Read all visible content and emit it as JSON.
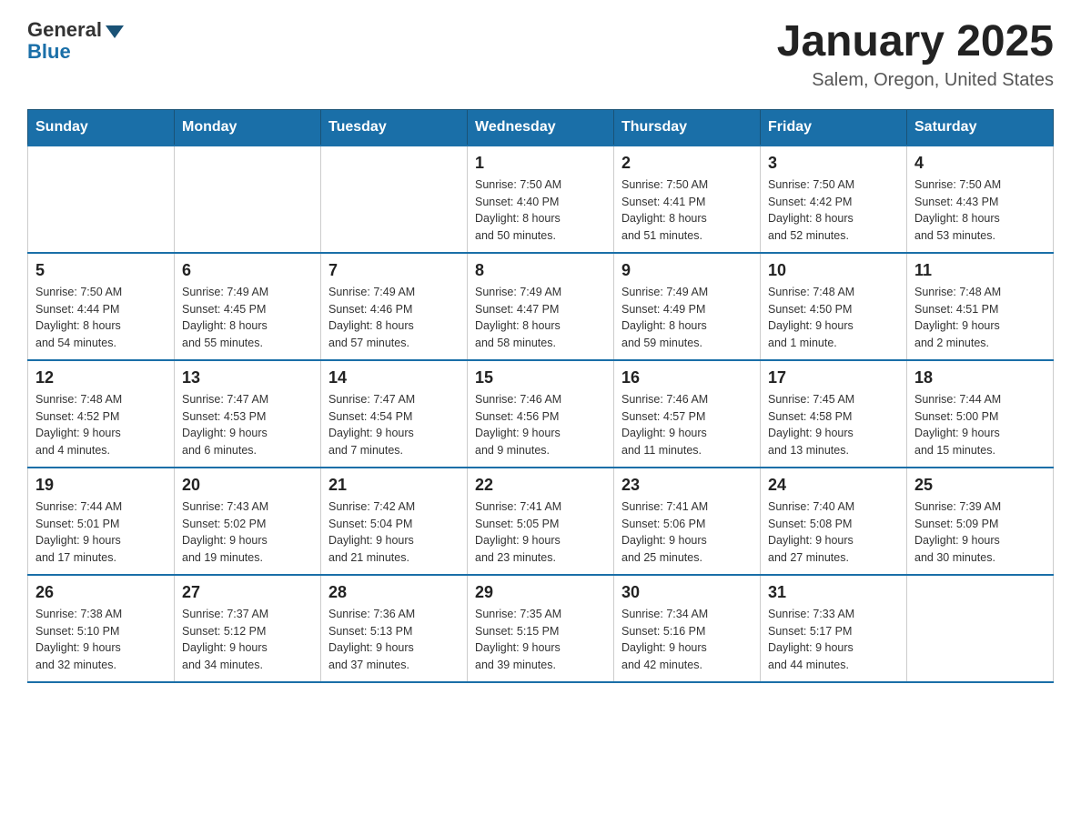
{
  "header": {
    "logo_general": "General",
    "logo_blue": "Blue",
    "month_title": "January 2025",
    "location": "Salem, Oregon, United States"
  },
  "days_of_week": [
    "Sunday",
    "Monday",
    "Tuesday",
    "Wednesday",
    "Thursday",
    "Friday",
    "Saturday"
  ],
  "weeks": [
    [
      {
        "day": "",
        "info": ""
      },
      {
        "day": "",
        "info": ""
      },
      {
        "day": "",
        "info": ""
      },
      {
        "day": "1",
        "info": "Sunrise: 7:50 AM\nSunset: 4:40 PM\nDaylight: 8 hours\nand 50 minutes."
      },
      {
        "day": "2",
        "info": "Sunrise: 7:50 AM\nSunset: 4:41 PM\nDaylight: 8 hours\nand 51 minutes."
      },
      {
        "day": "3",
        "info": "Sunrise: 7:50 AM\nSunset: 4:42 PM\nDaylight: 8 hours\nand 52 minutes."
      },
      {
        "day": "4",
        "info": "Sunrise: 7:50 AM\nSunset: 4:43 PM\nDaylight: 8 hours\nand 53 minutes."
      }
    ],
    [
      {
        "day": "5",
        "info": "Sunrise: 7:50 AM\nSunset: 4:44 PM\nDaylight: 8 hours\nand 54 minutes."
      },
      {
        "day": "6",
        "info": "Sunrise: 7:49 AM\nSunset: 4:45 PM\nDaylight: 8 hours\nand 55 minutes."
      },
      {
        "day": "7",
        "info": "Sunrise: 7:49 AM\nSunset: 4:46 PM\nDaylight: 8 hours\nand 57 minutes."
      },
      {
        "day": "8",
        "info": "Sunrise: 7:49 AM\nSunset: 4:47 PM\nDaylight: 8 hours\nand 58 minutes."
      },
      {
        "day": "9",
        "info": "Sunrise: 7:49 AM\nSunset: 4:49 PM\nDaylight: 8 hours\nand 59 minutes."
      },
      {
        "day": "10",
        "info": "Sunrise: 7:48 AM\nSunset: 4:50 PM\nDaylight: 9 hours\nand 1 minute."
      },
      {
        "day": "11",
        "info": "Sunrise: 7:48 AM\nSunset: 4:51 PM\nDaylight: 9 hours\nand 2 minutes."
      }
    ],
    [
      {
        "day": "12",
        "info": "Sunrise: 7:48 AM\nSunset: 4:52 PM\nDaylight: 9 hours\nand 4 minutes."
      },
      {
        "day": "13",
        "info": "Sunrise: 7:47 AM\nSunset: 4:53 PM\nDaylight: 9 hours\nand 6 minutes."
      },
      {
        "day": "14",
        "info": "Sunrise: 7:47 AM\nSunset: 4:54 PM\nDaylight: 9 hours\nand 7 minutes."
      },
      {
        "day": "15",
        "info": "Sunrise: 7:46 AM\nSunset: 4:56 PM\nDaylight: 9 hours\nand 9 minutes."
      },
      {
        "day": "16",
        "info": "Sunrise: 7:46 AM\nSunset: 4:57 PM\nDaylight: 9 hours\nand 11 minutes."
      },
      {
        "day": "17",
        "info": "Sunrise: 7:45 AM\nSunset: 4:58 PM\nDaylight: 9 hours\nand 13 minutes."
      },
      {
        "day": "18",
        "info": "Sunrise: 7:44 AM\nSunset: 5:00 PM\nDaylight: 9 hours\nand 15 minutes."
      }
    ],
    [
      {
        "day": "19",
        "info": "Sunrise: 7:44 AM\nSunset: 5:01 PM\nDaylight: 9 hours\nand 17 minutes."
      },
      {
        "day": "20",
        "info": "Sunrise: 7:43 AM\nSunset: 5:02 PM\nDaylight: 9 hours\nand 19 minutes."
      },
      {
        "day": "21",
        "info": "Sunrise: 7:42 AM\nSunset: 5:04 PM\nDaylight: 9 hours\nand 21 minutes."
      },
      {
        "day": "22",
        "info": "Sunrise: 7:41 AM\nSunset: 5:05 PM\nDaylight: 9 hours\nand 23 minutes."
      },
      {
        "day": "23",
        "info": "Sunrise: 7:41 AM\nSunset: 5:06 PM\nDaylight: 9 hours\nand 25 minutes."
      },
      {
        "day": "24",
        "info": "Sunrise: 7:40 AM\nSunset: 5:08 PM\nDaylight: 9 hours\nand 27 minutes."
      },
      {
        "day": "25",
        "info": "Sunrise: 7:39 AM\nSunset: 5:09 PM\nDaylight: 9 hours\nand 30 minutes."
      }
    ],
    [
      {
        "day": "26",
        "info": "Sunrise: 7:38 AM\nSunset: 5:10 PM\nDaylight: 9 hours\nand 32 minutes."
      },
      {
        "day": "27",
        "info": "Sunrise: 7:37 AM\nSunset: 5:12 PM\nDaylight: 9 hours\nand 34 minutes."
      },
      {
        "day": "28",
        "info": "Sunrise: 7:36 AM\nSunset: 5:13 PM\nDaylight: 9 hours\nand 37 minutes."
      },
      {
        "day": "29",
        "info": "Sunrise: 7:35 AM\nSunset: 5:15 PM\nDaylight: 9 hours\nand 39 minutes."
      },
      {
        "day": "30",
        "info": "Sunrise: 7:34 AM\nSunset: 5:16 PM\nDaylight: 9 hours\nand 42 minutes."
      },
      {
        "day": "31",
        "info": "Sunrise: 7:33 AM\nSunset: 5:17 PM\nDaylight: 9 hours\nand 44 minutes."
      },
      {
        "day": "",
        "info": ""
      }
    ]
  ]
}
